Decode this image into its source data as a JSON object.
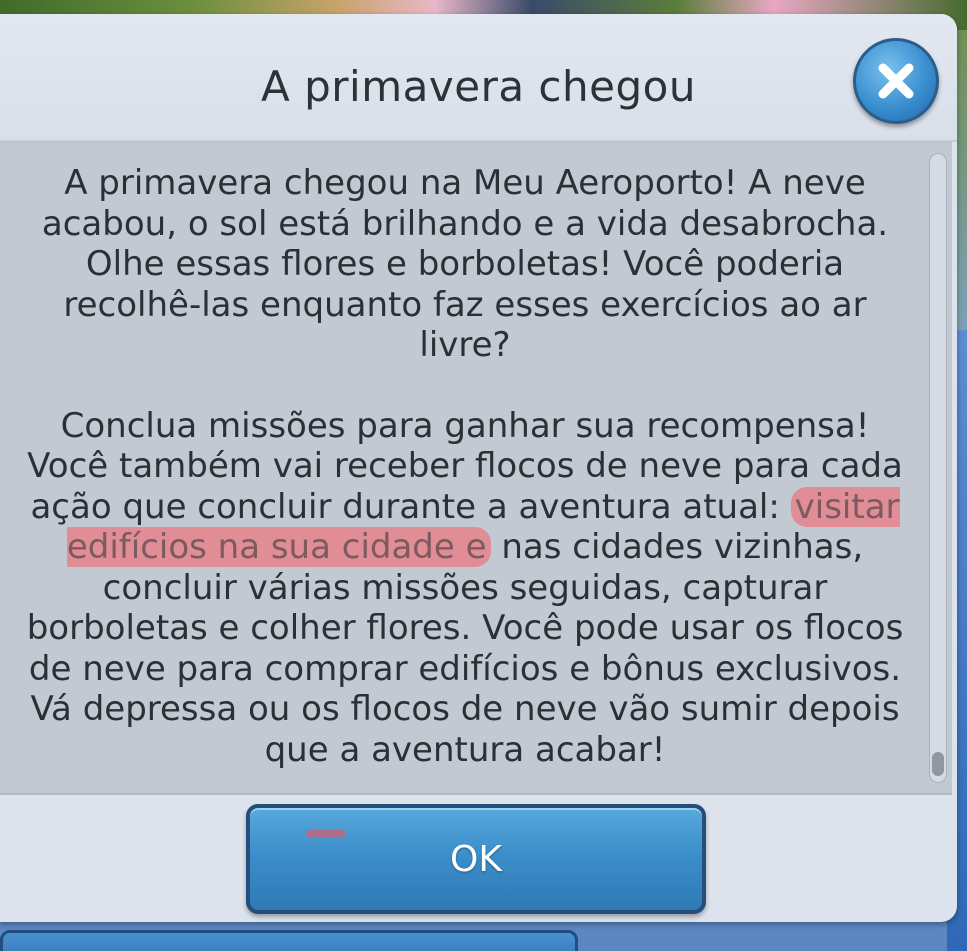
{
  "dialog": {
    "title": "A primavera chegou",
    "paragraph1": "A primavera chegou na Meu Aeroporto! A neve acabou, o sol está brilhando e a vida desabrocha. Olhe essas flores e borboletas! Você poderia recolhê-las enquanto faz esses exercícios ao ar livre?",
    "paragraph2_before": "Conclua missões para ganhar sua recompensa! Você também vai receber flocos de neve para cada ação que concluir durante a aventura atual: ",
    "paragraph2_highlight": "visitar edifícios na sua cidade e",
    "paragraph2_after": " nas cidades vizinhas, concluir várias missões seguidas, capturar borboletas e colher flores. Você pode usar os flocos de neve para comprar edifícios e bônus exclusivos. Vá depressa ou os flocos de neve vão sumir depois que a aventura acabar!",
    "ok_label": "OK",
    "close_icon": "close-x-icon"
  },
  "colors": {
    "accent": "#3a8cc8",
    "highlight": "#e97882",
    "panel": "#c2c9d3",
    "header": "#dde3ec"
  }
}
